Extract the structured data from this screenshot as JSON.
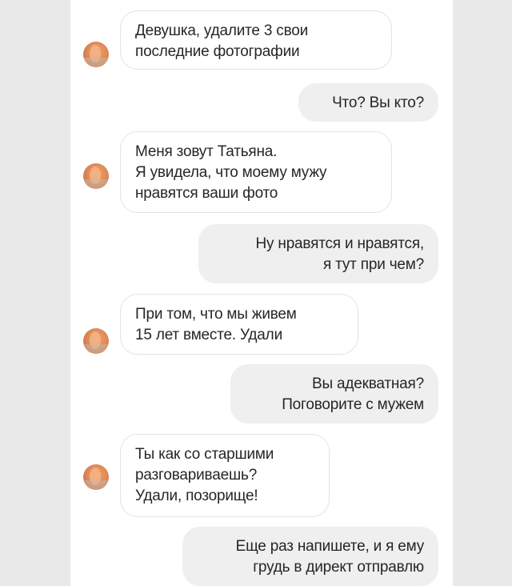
{
  "colors": {
    "page_background": "#e9e9ea",
    "panel_background": "#ffffff",
    "incoming_bubble": "#ffffff",
    "incoming_border": "#e3e3e3",
    "outgoing_bubble": "#efefef",
    "text": "#262626"
  },
  "contact": {
    "avatar_icon": "avatar-icon"
  },
  "messages": [
    {
      "direction": "incoming",
      "text": "Девушка, удалите 3 свои\nпоследние фотографии"
    },
    {
      "direction": "outgoing",
      "text": "Что? Вы кто?"
    },
    {
      "direction": "incoming",
      "text": "Меня зовут Татьяна.\nЯ увидела, что моему мужу\nнравятся ваши фото"
    },
    {
      "direction": "outgoing",
      "text": "Ну нравятся и нравятся,\nя тут при чем?"
    },
    {
      "direction": "incoming",
      "text": "При том, что мы живем\n15 лет вместе. Удали"
    },
    {
      "direction": "outgoing",
      "text": "Вы адекватная?\nПоговорите с мужем"
    },
    {
      "direction": "incoming",
      "text": "Ты как со старшими\nразговариваешь?\nУдали, позорище!"
    },
    {
      "direction": "outgoing",
      "text": "Еще раз напишете, и я ему\nгрудь в директ отправлю"
    }
  ]
}
